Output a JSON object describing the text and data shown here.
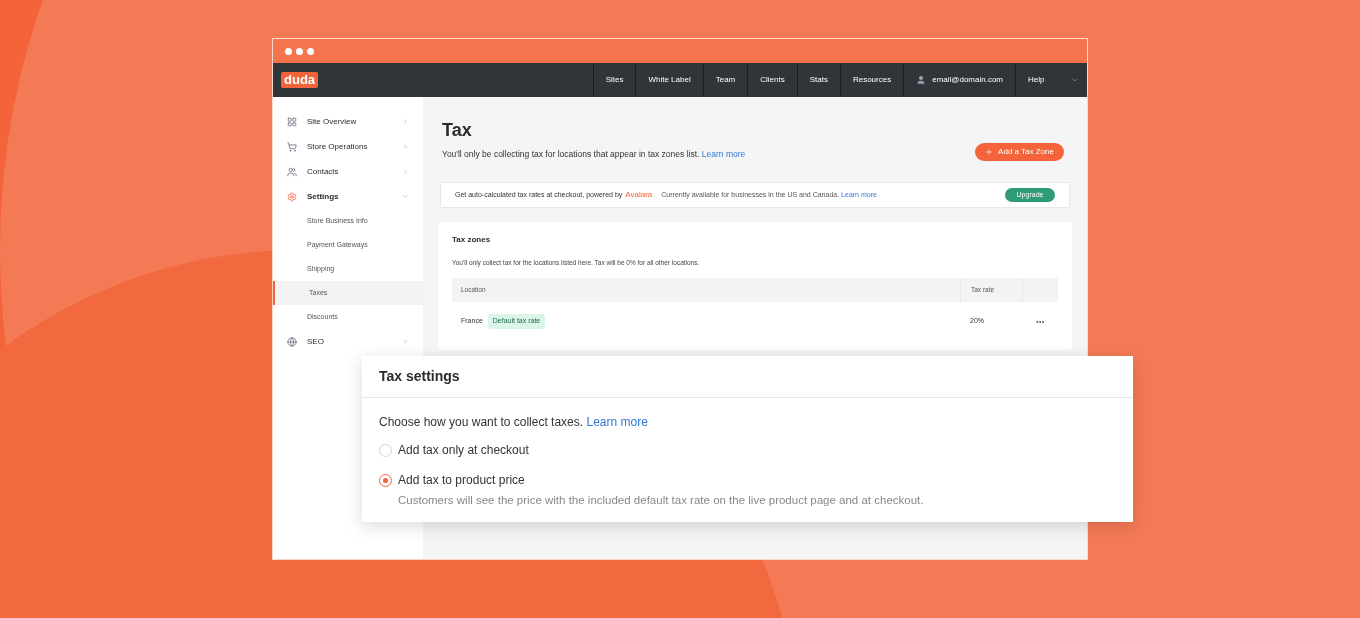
{
  "nav": {
    "logo": "duda",
    "items": [
      {
        "label": "Sites",
        "kind": "link"
      },
      {
        "label": "White Label",
        "kind": "link"
      },
      {
        "label": "Team",
        "kind": "link"
      },
      {
        "label": "Clients",
        "kind": "link"
      },
      {
        "label": "Stats",
        "kind": "link"
      },
      {
        "label": "Resources",
        "kind": "link"
      },
      {
        "label": "email@domain.com",
        "kind": "account"
      },
      {
        "label": "Help",
        "kind": "menu"
      }
    ]
  },
  "sidebar": {
    "items": [
      {
        "label": "Site Overview",
        "expanded": false,
        "selected": false
      },
      {
        "label": "Store Operations",
        "expanded": false,
        "selected": false
      },
      {
        "label": "Contacts",
        "expanded": false,
        "selected": false
      },
      {
        "label": "Settings",
        "expanded": true,
        "selected": true,
        "children": [
          {
            "label": "Store Business Info",
            "selected": false
          },
          {
            "label": "Payment Gateways",
            "selected": false
          },
          {
            "label": "Shipping",
            "selected": false
          },
          {
            "label": "Taxes",
            "selected": true
          },
          {
            "label": "Discounts",
            "selected": false
          }
        ]
      },
      {
        "label": "SEO",
        "expanded": false,
        "selected": false
      }
    ]
  },
  "page": {
    "title": "Tax",
    "subtitle": "You'll only be collecting tax for locations that appear in tax zones list.",
    "subtitle_link": "Learn more",
    "add_button": "Add a Tax Zone"
  },
  "banner": {
    "text": "Get auto-calculated tax rates at checkout, powered by",
    "brand": "Avalara",
    "note": "Currently available for businesses in the US and Canada.",
    "note_link": "Learn more",
    "button": "Upgrade"
  },
  "tax_zones": {
    "title": "Tax zones",
    "description": "You'll only collect tax for the locations listed here. Tax will be 0% for all other locations.",
    "columns": [
      "Location",
      "Tax rate"
    ],
    "rows": [
      {
        "location": "France",
        "badge": "Default tax rate",
        "rate": "20%"
      }
    ]
  },
  "tax_settings": {
    "title": "Tax settings",
    "prompt": "Choose how you want to collect taxes.",
    "prompt_link": "Learn more",
    "options": [
      {
        "label": "Add tax only at checkout",
        "selected": false
      },
      {
        "label": "Add tax to product price",
        "selected": true,
        "description": "Customers will see the price with the included default tax rate on the live product page and at checkout."
      }
    ]
  }
}
